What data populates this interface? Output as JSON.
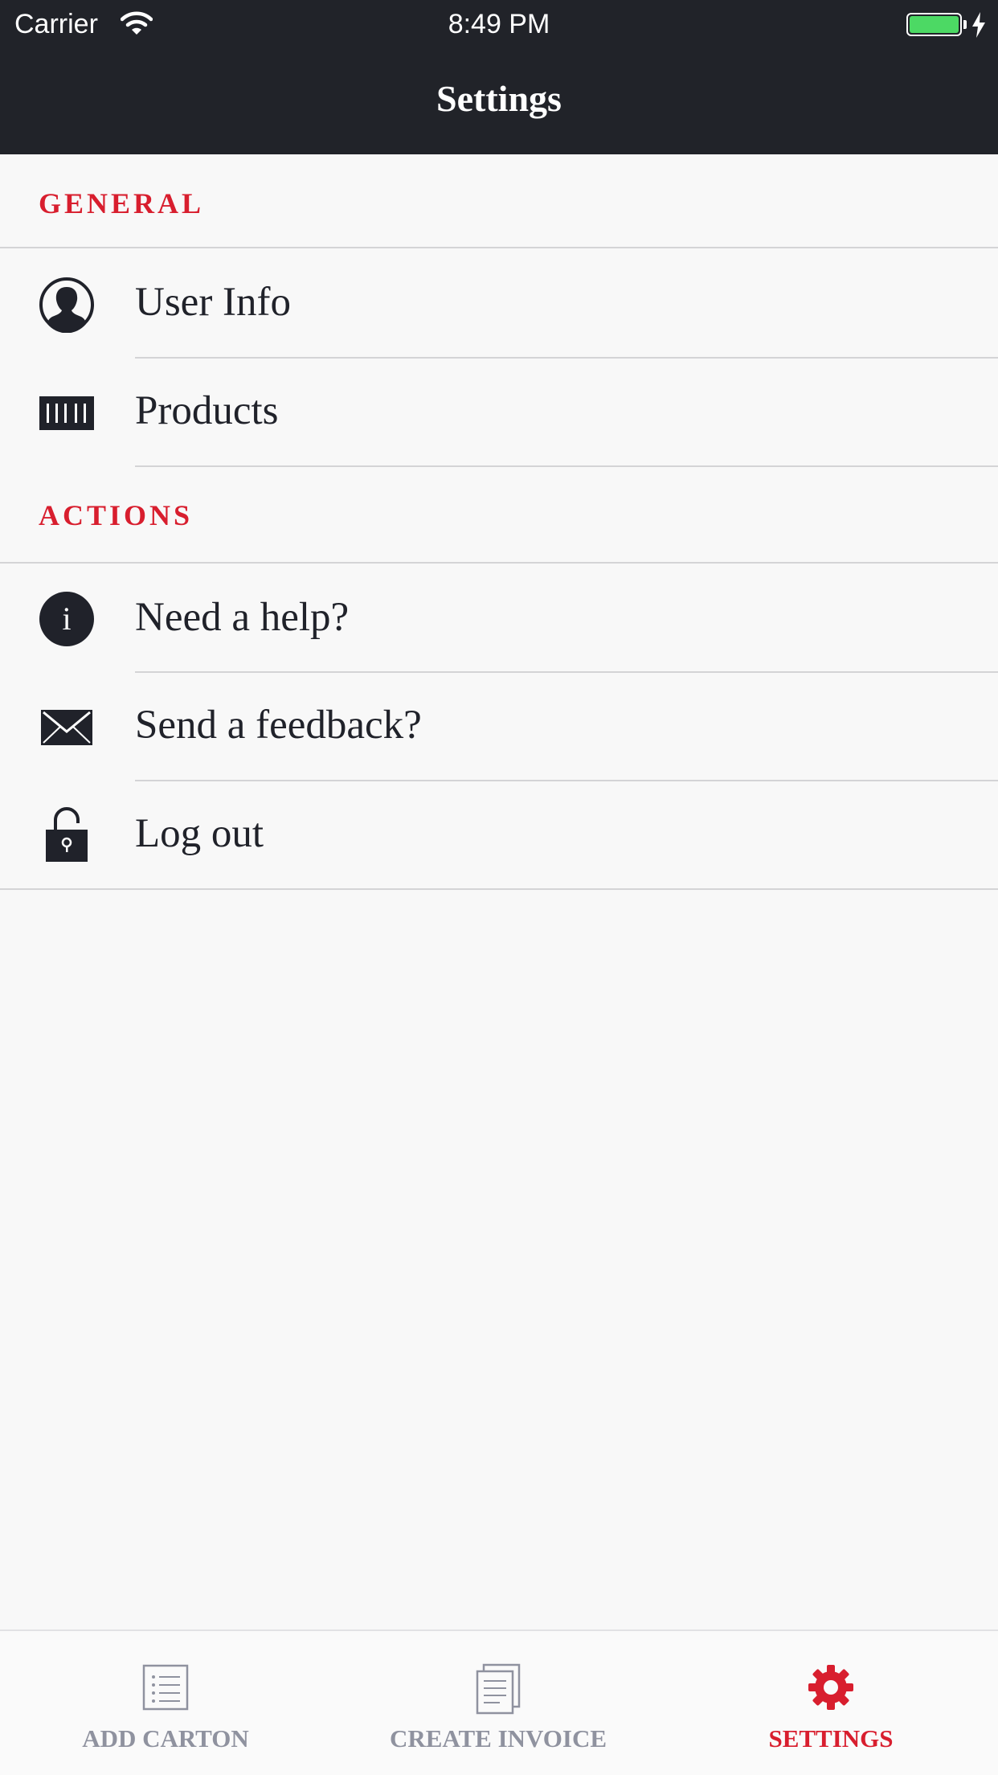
{
  "status_bar": {
    "carrier": "Carrier",
    "time": "8:49 PM",
    "battery_color": "#4cd964"
  },
  "nav": {
    "title": "Settings"
  },
  "sections": {
    "general": {
      "header": "GENERAL",
      "items": [
        {
          "label": "User Info",
          "icon": "user-icon"
        },
        {
          "label": "Products",
          "icon": "barcode-icon"
        }
      ]
    },
    "actions": {
      "header": "ACTIONS",
      "items": [
        {
          "label": "Need a help?",
          "icon": "info-icon"
        },
        {
          "label": "Send a feedback?",
          "icon": "envelope-icon"
        },
        {
          "label": "Log out",
          "icon": "unlock-icon"
        }
      ]
    }
  },
  "tab_bar": {
    "tabs": [
      {
        "label": "ADD CARTON",
        "icon": "list-icon",
        "active": false
      },
      {
        "label": "CREATE INVOICE",
        "icon": "document-icon",
        "active": false
      },
      {
        "label": "SETTINGS",
        "icon": "gear-icon",
        "active": true
      }
    ]
  },
  "colors": {
    "accent": "#d81e2e",
    "navbar": "#212329",
    "background": "#f8f8f8",
    "inactive_tab": "#8f929f"
  }
}
